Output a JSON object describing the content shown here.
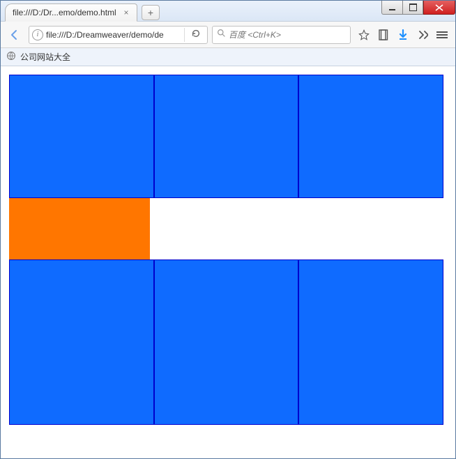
{
  "window": {
    "min_tooltip": "Minimize",
    "max_tooltip": "Maximize",
    "close_tooltip": "Close"
  },
  "tabs": [
    {
      "title": "file:///D:/Dr...emo/demo.html"
    }
  ],
  "newtab_label": "+",
  "nav": {
    "url": "file:///D:/Dreamweaver/demo/de",
    "search_placeholder": "百度 <Ctrl+K>"
  },
  "bookmarks": [
    {
      "label": "公司网站大全"
    }
  ],
  "page": {
    "rows": 3,
    "cols": 3,
    "cell_color": "#0f6bff",
    "accent_color": "#ff7600",
    "border_color": "#0000cd"
  }
}
